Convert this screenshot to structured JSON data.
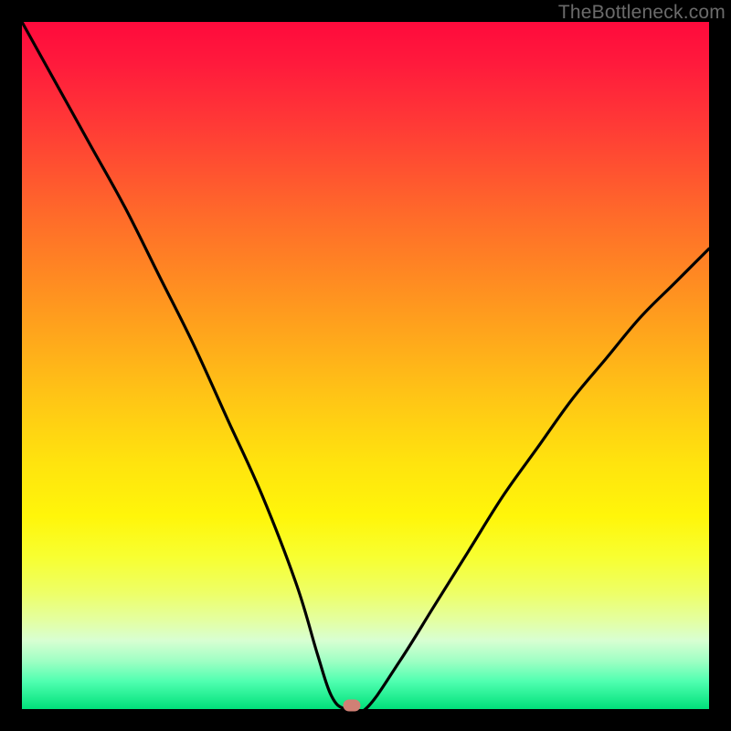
{
  "watermark": "TheBottleneck.com",
  "chart_data": {
    "type": "line",
    "title": "",
    "xlabel": "",
    "ylabel": "",
    "xlim": [
      0,
      100
    ],
    "ylim": [
      0,
      100
    ],
    "grid": false,
    "legend": false,
    "background_gradient": {
      "orientation": "vertical",
      "stops": [
        {
          "pos": 0.0,
          "color": "#ff0a3c"
        },
        {
          "pos": 0.28,
          "color": "#ff6a2a"
        },
        {
          "pos": 0.54,
          "color": "#ffc316"
        },
        {
          "pos": 0.72,
          "color": "#fff60a"
        },
        {
          "pos": 0.9,
          "color": "#d8ffd2"
        },
        {
          "pos": 1.0,
          "color": "#00e07a"
        }
      ]
    },
    "series": [
      {
        "name": "bottleneck-curve",
        "color": "#000000",
        "x": [
          0,
          5,
          10,
          15,
          20,
          25,
          30,
          35,
          40,
          43,
          45,
          47,
          50,
          55,
          60,
          65,
          70,
          75,
          80,
          85,
          90,
          95,
          100
        ],
        "y": [
          100,
          91,
          82,
          73,
          63,
          53,
          42,
          31,
          18,
          8,
          2,
          0,
          0,
          7,
          15,
          23,
          31,
          38,
          45,
          51,
          57,
          62,
          67
        ]
      }
    ],
    "marker": {
      "name": "optimal-point",
      "x": 48,
      "y": 0,
      "color": "#d08075",
      "shape": "pill"
    }
  }
}
